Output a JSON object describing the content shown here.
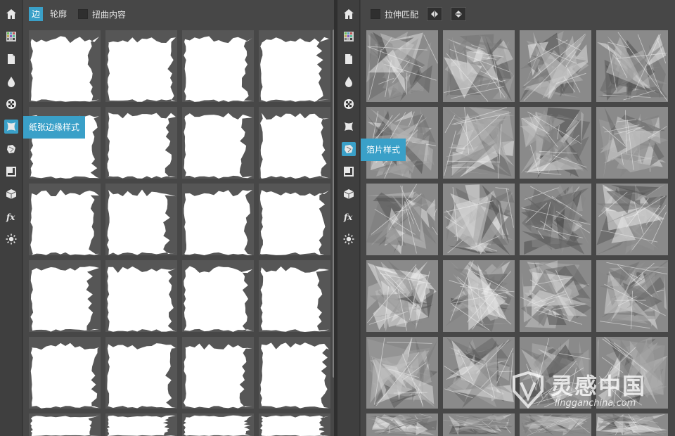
{
  "left_panel": {
    "tabs": [
      {
        "label": "边",
        "active": true
      },
      {
        "label": "轮廓",
        "active": false
      }
    ],
    "checkbox_label": "扭曲内容",
    "tooltip": "纸张边缘样式",
    "thumbnails_count": 24
  },
  "right_panel": {
    "checkbox_label": "拉伸匹配",
    "buttons": [
      "flip-horizontal-icon",
      "flip-vertical-icon"
    ],
    "tooltip": "箔片样式",
    "thumbnails_count": 24
  },
  "sidebar_tools": [
    "home-icon",
    "swatches-icon",
    "document-icon",
    "drop-icon",
    "checker-icon",
    "paper-edge-icon",
    "foil-icon",
    "square-icon",
    "cube-icon",
    "fx-icon",
    "sun-icon"
  ],
  "watermark": {
    "brand": "灵感中国",
    "url": "lingganchina.com"
  },
  "colors": {
    "accent": "#3aa0c8",
    "panel": "#474747",
    "cell_bg": "#565656"
  }
}
